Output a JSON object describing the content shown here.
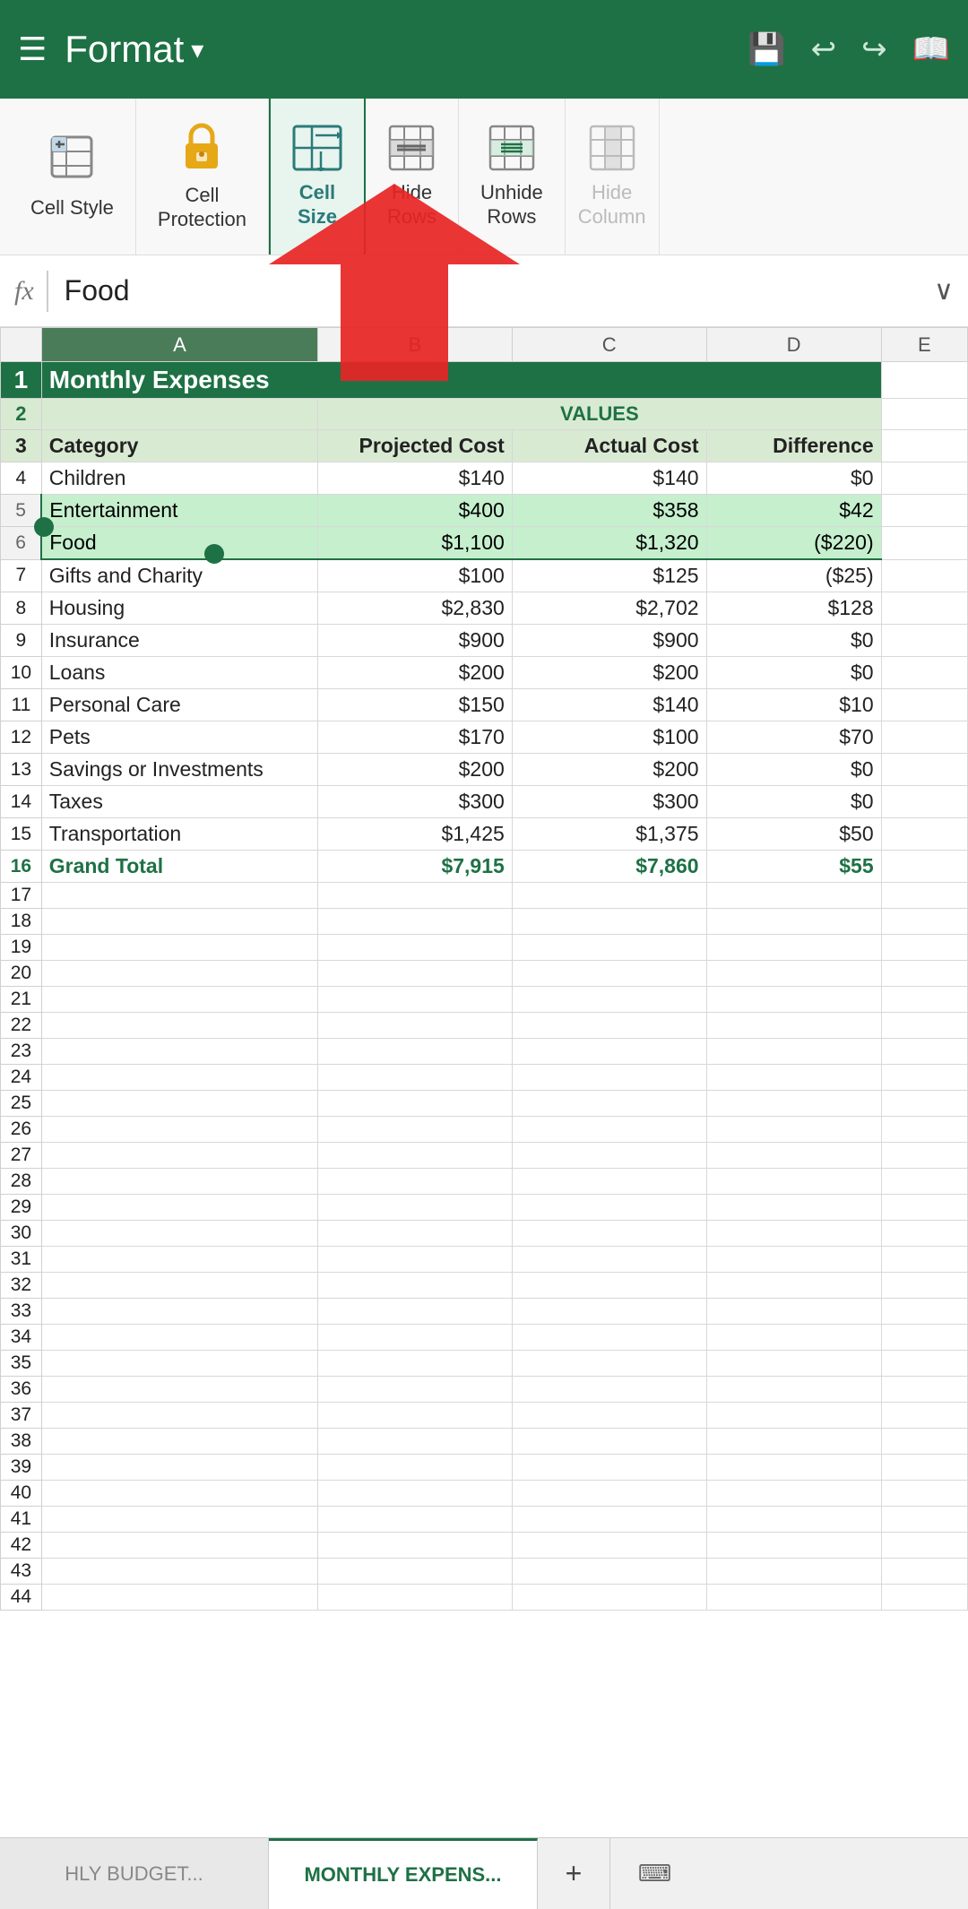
{
  "toolbar": {
    "menu_icon": "☰",
    "title": "Format",
    "dropdown_arrow": "▾",
    "save_icon": "💾",
    "undo_icon": "↩",
    "redo_icon": "↪",
    "book_icon": "📖"
  },
  "ribbon": {
    "items": [
      {
        "id": "cell-style",
        "icon": "cell_style",
        "label": "Cell\nStyle",
        "icon_char": "✏"
      },
      {
        "id": "cell-protection",
        "icon": "lock",
        "label": "Cell\nProtection",
        "icon_char": "🔒"
      },
      {
        "id": "cell-size",
        "icon": "cell_size",
        "label": "Cell\nSize",
        "icon_char": "⊞"
      },
      {
        "id": "hide-rows",
        "icon": "hide_rows",
        "label": "Hide\nRows",
        "icon_char": "▦"
      },
      {
        "id": "unhide-rows",
        "icon": "unhide_rows",
        "label": "Unhide\nRows",
        "icon_char": "▦"
      },
      {
        "id": "hide-columns",
        "icon": "hide_cols",
        "label": "Hide\nColumn",
        "icon_char": "▥"
      }
    ]
  },
  "formula_bar": {
    "fx_label": "fx",
    "value": "Food",
    "expand_label": "∨"
  },
  "spreadsheet": {
    "col_headers": [
      "",
      "A",
      "B",
      "C",
      "D",
      "E"
    ],
    "title_row": {
      "row_num": "1",
      "value": "Monthly Expenses"
    },
    "values_row": {
      "row_num": "2",
      "label": "VALUES"
    },
    "header_row": {
      "row_num": "3",
      "cols": [
        "Category",
        "Projected Cost",
        "Actual Cost",
        "Difference"
      ]
    },
    "data_rows": [
      {
        "row_num": "4",
        "category": "Children",
        "projected": "$140",
        "actual": "$140",
        "diff": "$0"
      },
      {
        "row_num": "5",
        "category": "Entertainment",
        "projected": "$400",
        "actual": "$358",
        "diff": "$42"
      },
      {
        "row_num": "6",
        "category": "Food",
        "projected": "$1,100",
        "actual": "$1,320",
        "diff": "($220)"
      },
      {
        "row_num": "7",
        "category": "Gifts and Charity",
        "projected": "$100",
        "actual": "$125",
        "diff": "($25)"
      },
      {
        "row_num": "8",
        "category": "Housing",
        "projected": "$2,830",
        "actual": "$2,702",
        "diff": "$128"
      },
      {
        "row_num": "9",
        "category": "Insurance",
        "projected": "$900",
        "actual": "$900",
        "diff": "$0"
      },
      {
        "row_num": "10",
        "category": "Loans",
        "projected": "$200",
        "actual": "$200",
        "diff": "$0"
      },
      {
        "row_num": "11",
        "category": "Personal Care",
        "projected": "$150",
        "actual": "$140",
        "diff": "$10"
      },
      {
        "row_num": "12",
        "category": "Pets",
        "projected": "$170",
        "actual": "$100",
        "diff": "$70"
      },
      {
        "row_num": "13",
        "category": "Savings or Investments",
        "projected": "$200",
        "actual": "$200",
        "diff": "$0"
      },
      {
        "row_num": "14",
        "category": "Taxes",
        "projected": "$300",
        "actual": "$300",
        "diff": "$0"
      },
      {
        "row_num": "15",
        "category": "Transportation",
        "projected": "$1,425",
        "actual": "$1,375",
        "diff": "$50"
      },
      {
        "row_num": "16",
        "category": "Grand Total",
        "projected": "$7,915",
        "actual": "$7,860",
        "diff": "$55",
        "is_grand": true
      }
    ],
    "empty_rows": [
      "17",
      "18",
      "19",
      "20",
      "21",
      "22",
      "23",
      "24",
      "25",
      "26",
      "27",
      "28",
      "29",
      "30",
      "31",
      "32",
      "33",
      "34",
      "35",
      "36",
      "37",
      "38",
      "39",
      "40",
      "41",
      "42",
      "43",
      "44"
    ]
  },
  "sheet_tabs": {
    "tab1_label": "HLY BUDGET...",
    "tab2_label": "MONTHLY EXPENS...",
    "add_label": "+",
    "kbd_label": "⌨"
  }
}
